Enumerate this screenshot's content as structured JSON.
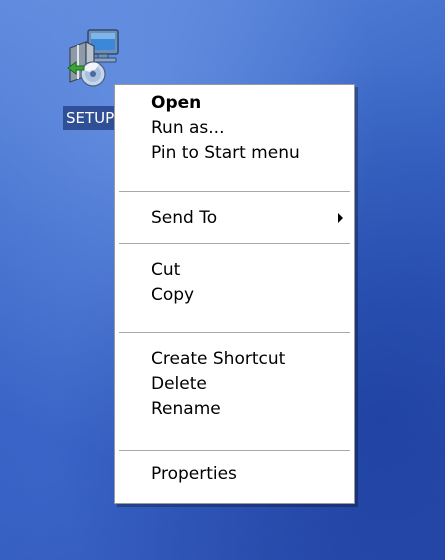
{
  "desktop": {
    "icon": {
      "name": "setup-icon",
      "label": "SETUP"
    }
  },
  "context_menu": {
    "groups": [
      [
        {
          "label": "Open",
          "default": true
        },
        {
          "label": "Run as..."
        },
        {
          "label": "Pin to Start menu"
        }
      ],
      [
        {
          "label": "Send To",
          "submenu": true
        }
      ],
      [
        {
          "label": "Cut"
        },
        {
          "label": "Copy"
        }
      ],
      [
        {
          "label": "Create Shortcut"
        },
        {
          "label": "Delete"
        },
        {
          "label": "Rename"
        }
      ],
      [
        {
          "label": "Properties"
        }
      ]
    ]
  },
  "colors": {
    "desktop_blue": "#3e6bc9",
    "selection": "#2f4f96",
    "menu_bg": "#ffffff",
    "separator": "#a8a8a8"
  }
}
